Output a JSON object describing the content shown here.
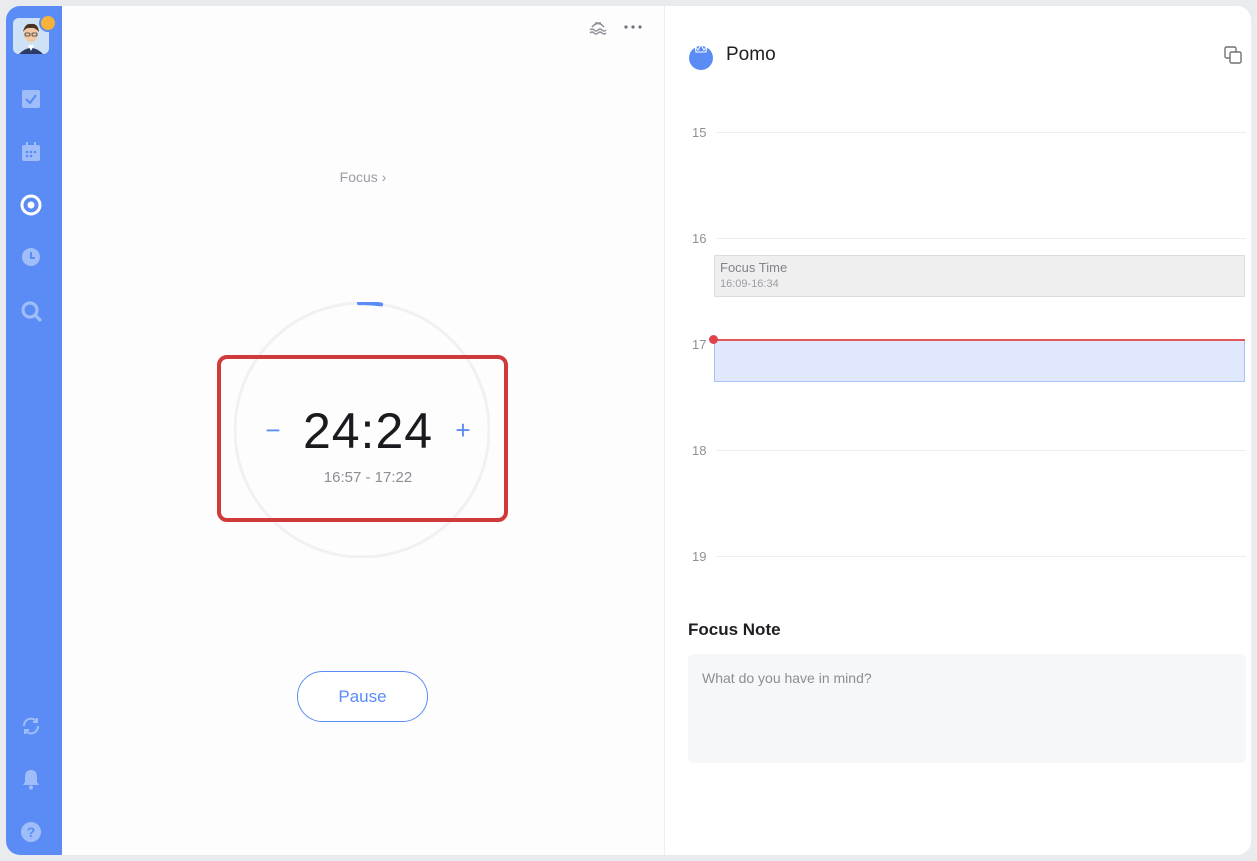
{
  "sidebar": {
    "items": [
      {
        "icon": "checkbox-icon"
      },
      {
        "icon": "calendar-icon"
      },
      {
        "icon": "pomodoro-icon"
      },
      {
        "icon": "clock-icon"
      },
      {
        "icon": "search-icon"
      }
    ],
    "bottom": [
      {
        "icon": "sync-icon"
      },
      {
        "icon": "bell-icon"
      },
      {
        "icon": "help-icon"
      }
    ],
    "accent": "#5b8cf6"
  },
  "timer": {
    "mode_link": "Focus",
    "time": "24:24",
    "range": "16:57 - 17:22",
    "pause_label": "Pause",
    "minus_label": "−",
    "plus_label": "+",
    "progress": 0.024
  },
  "pomo": {
    "title": "Pomo",
    "hours": [
      "15",
      "16",
      "17",
      "18",
      "19"
    ],
    "events": [
      {
        "title": "Focus Time",
        "time": "16:09-16:34"
      }
    ],
    "note_heading": "Focus Note",
    "note_placeholder": "What do you have in mind?"
  },
  "colors": {
    "accent": "#5b8cf6",
    "highlight": "#d03a3a",
    "now_line": "#e0575c"
  }
}
